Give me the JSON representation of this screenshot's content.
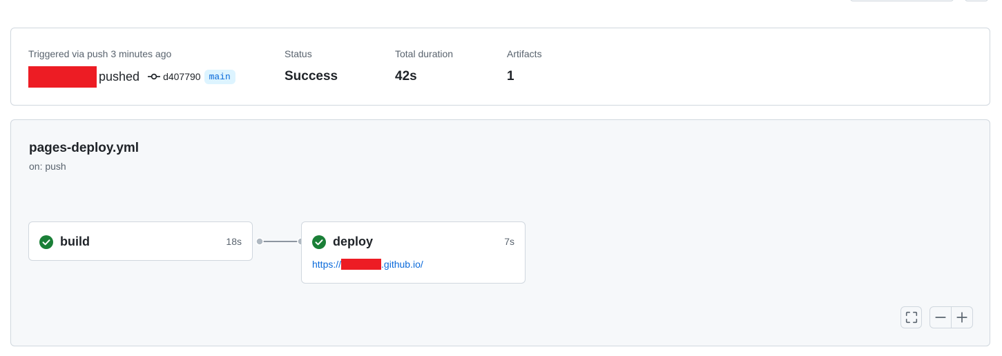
{
  "summary": {
    "trigger_label": "Triggered via push 3 minutes ago",
    "actor_action": "pushed",
    "commit_sha": "d407790",
    "branch": "main",
    "status_label": "Status",
    "status_value": "Success",
    "duration_label": "Total duration",
    "duration_value": "42s",
    "artifacts_label": "Artifacts",
    "artifacts_value": "1"
  },
  "workflow": {
    "file": "pages-deploy.yml",
    "event": "on: push"
  },
  "jobs": [
    {
      "name": "build",
      "duration": "18s",
      "status": "success"
    },
    {
      "name": "deploy",
      "duration": "7s",
      "status": "success",
      "link_prefix": "https://",
      "link_suffix": ".github.io/"
    }
  ],
  "icons": {
    "commit": "git-commit-icon",
    "check": "check-circle-fill-icon",
    "fullscreen": "screen-full-icon",
    "zoom_out": "dash-icon",
    "zoom_in": "plus-icon"
  },
  "colors": {
    "success": "#1a7f37",
    "link": "#0969da",
    "branch_bg": "#ddf4ff",
    "redaction": "#ed1c24"
  }
}
